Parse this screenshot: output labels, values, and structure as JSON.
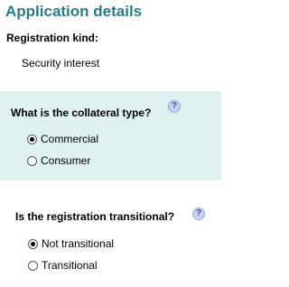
{
  "header": {
    "title": "Application details"
  },
  "registration": {
    "label": "Registration kind:",
    "value": "Security interest"
  },
  "collateral_question": {
    "text": "What is the collateral type?",
    "help_icon": "?",
    "options": [
      {
        "label": "Commercial",
        "selected": true
      },
      {
        "label": "Consumer",
        "selected": false
      }
    ]
  },
  "transitional_question": {
    "text": "Is the registration transitional?",
    "help_icon": "?",
    "options": [
      {
        "label": "Not transitional",
        "selected": true
      },
      {
        "label": "Transitional",
        "selected": false
      }
    ]
  },
  "colors": {
    "title": "#2e7a83",
    "panel_background": "#dff1f1",
    "help_icon": "#c9d2ec"
  },
  "icons": {
    "help": "help-icon",
    "radio_selected": "radio-selected-icon",
    "radio_unselected": "radio-unselected-icon"
  }
}
